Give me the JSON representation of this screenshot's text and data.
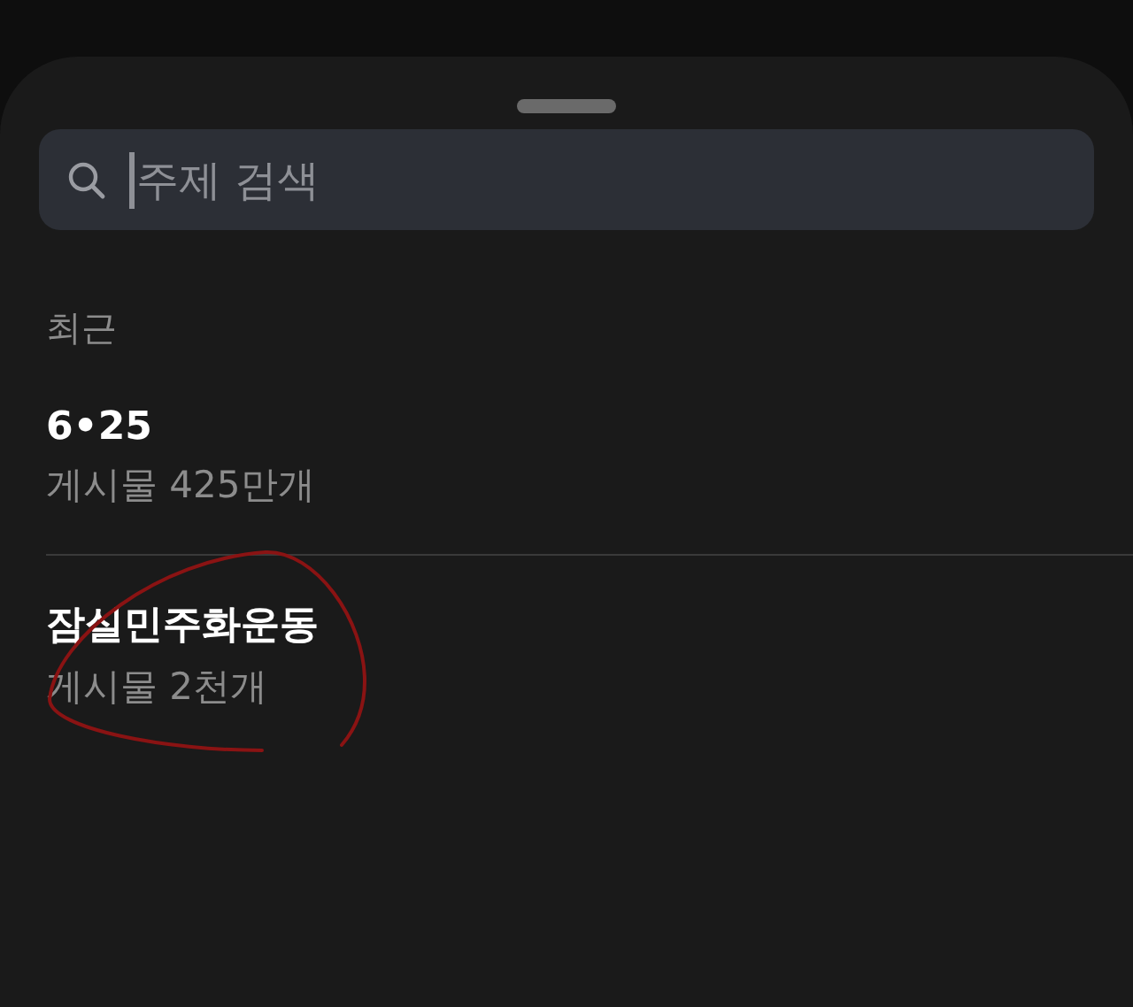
{
  "search": {
    "placeholder": "주제 검색",
    "focused": true
  },
  "section_title": "최근",
  "topics": [
    {
      "title": "6•25",
      "subtitle": "게시물 425만개"
    },
    {
      "title": "잠실민주화운동",
      "subtitle": "게시물 2천개"
    }
  ]
}
